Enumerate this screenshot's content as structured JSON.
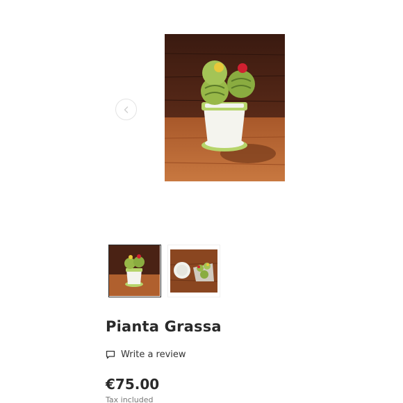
{
  "product": {
    "title": "Pianta Grassa",
    "review_label": "Write a review",
    "price": "€75.00",
    "tax_note": "Tax included"
  },
  "gallery": {
    "main_image": "knitted-cactus-pot-photo",
    "thumbnails": [
      "cactus-pot-thumbnail",
      "cactus-pincushions-thumbnail"
    ],
    "selected_index": 0
  },
  "icons": {
    "prev": "chevron-left-icon",
    "review": "comment-icon"
  },
  "colors": {
    "text": "#2a2a2a",
    "muted": "#777777",
    "selected_border": "#2b2b2b"
  }
}
